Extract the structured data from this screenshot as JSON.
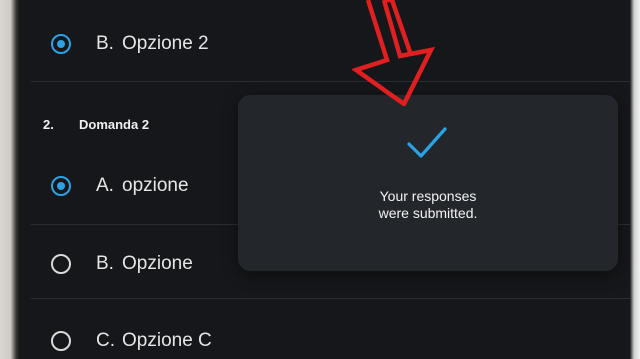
{
  "form": {
    "previous_question_option": {
      "letter": "B.",
      "text": "Opzione 2",
      "selected": true
    },
    "question": {
      "number": "2.",
      "title": "Domanda 2",
      "options": [
        {
          "letter": "A.",
          "text": "opzione",
          "selected": true
        },
        {
          "letter": "B.",
          "text": "Opzione",
          "selected": false
        },
        {
          "letter": "C.",
          "text": "Opzione C",
          "selected": false
        }
      ]
    }
  },
  "toast": {
    "icon": "checkmark-icon",
    "message_line1": "Your responses",
    "message_line2": "were submitted."
  },
  "annotation": {
    "icon": "red-arrow-down-icon",
    "color": "#e02020"
  },
  "colors": {
    "accent": "#2aa3e6",
    "background": "#15171a",
    "toast_bg": "#23272c"
  }
}
